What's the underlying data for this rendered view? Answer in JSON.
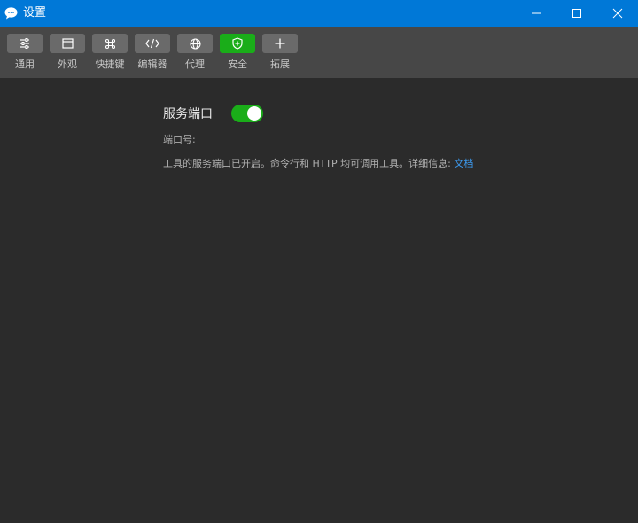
{
  "window": {
    "title": "设置"
  },
  "toolbar": {
    "items": [
      {
        "label": "通用",
        "icon": "sliders-icon",
        "active": false
      },
      {
        "label": "外观",
        "icon": "window-layout-icon",
        "active": false
      },
      {
        "label": "快捷键",
        "icon": "command-key-icon",
        "active": false
      },
      {
        "label": "编辑器",
        "icon": "code-icon",
        "active": false
      },
      {
        "label": "代理",
        "icon": "globe-icon",
        "active": false
      },
      {
        "label": "安全",
        "icon": "shield-icon",
        "active": true
      },
      {
        "label": "拓展",
        "icon": "plus-icon",
        "active": false
      }
    ]
  },
  "security": {
    "service_port_title": "服务端口",
    "service_port_enabled": true,
    "port_label": "端口号:",
    "description": "工具的服务端口已开启。命令行和 HTTP 均可调用工具。详细信息:",
    "doc_link": "文档"
  },
  "colors": {
    "titlebar": "#0078d7",
    "toolbar": "#474747",
    "background": "#2b2b2b",
    "active_green": "#1aad19",
    "link_blue": "#3d9bf0"
  }
}
